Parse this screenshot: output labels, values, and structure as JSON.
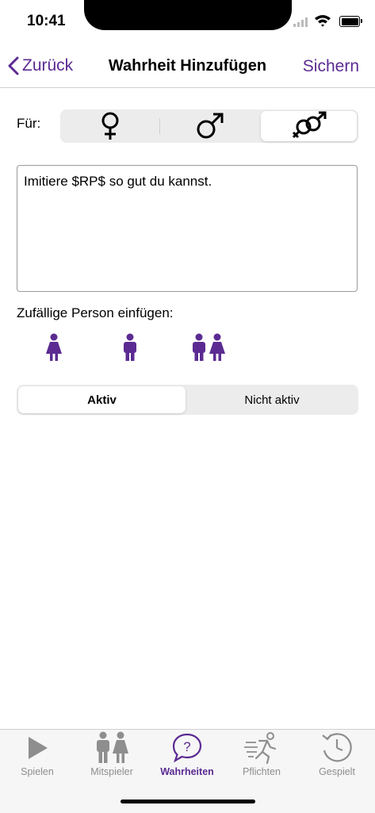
{
  "status_bar": {
    "time": "10:41"
  },
  "nav": {
    "back_label": "Zurück",
    "title": "Wahrheit Hinzufügen",
    "save_label": "Sichern"
  },
  "gender_selector": {
    "label": "Für:",
    "options": [
      "female-symbol",
      "male-symbol",
      "both-symbol"
    ],
    "selected": "both-symbol"
  },
  "truth_text": {
    "value": "Imitiere $RP$ so gut du kannst."
  },
  "random_person": {
    "label": "Zufällige Person einfügen:",
    "options": [
      "female-person-icon",
      "male-person-icon",
      "couple-person-icon"
    ]
  },
  "status_toggle": {
    "options": [
      "Aktiv",
      "Nicht aktiv"
    ],
    "selected": "Aktiv"
  },
  "tab_bar": {
    "items": [
      {
        "label": "Spielen",
        "icon": "play-icon"
      },
      {
        "label": "Mitspieler",
        "icon": "players-icon"
      },
      {
        "label": "Wahrheiten",
        "icon": "question-bubble-icon"
      },
      {
        "label": "Pflichten",
        "icon": "running-man-icon"
      },
      {
        "label": "Gespielt",
        "icon": "history-clock-icon"
      }
    ],
    "active": "Wahrheiten"
  },
  "colors": {
    "accent": "#5b2b92",
    "inactive": "#8e8e8e",
    "segment_bg": "#ececec"
  }
}
